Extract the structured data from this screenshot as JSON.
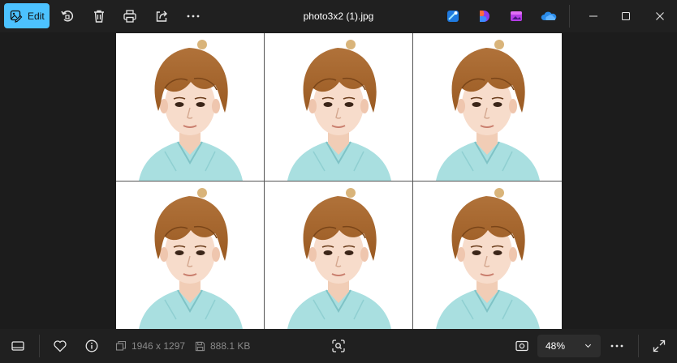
{
  "window": {
    "title": "photo3x2 (1).jpg"
  },
  "toolbar": {
    "edit_label": "Edit",
    "icons": [
      "rotate-icon",
      "delete-icon",
      "print-icon",
      "share-icon",
      "more-icon"
    ]
  },
  "app_shortcuts": [
    "designer-icon",
    "clipchamp-icon",
    "photo-editor-icon",
    "onedrive-icon"
  ],
  "window_controls": [
    "minimize-icon",
    "maximize-icon",
    "close-icon"
  ],
  "photo": {
    "layout": "3x2",
    "cells": 6
  },
  "status": {
    "dimensions": "1946 x 1297",
    "file_size": "888.1 KB",
    "zoom": "48%"
  },
  "colors": {
    "accent": "#4cc2ff",
    "background": "#1c1c1c",
    "bar": "#202020",
    "shirt": "#a9dfe0",
    "hair": "#9a5a22"
  }
}
